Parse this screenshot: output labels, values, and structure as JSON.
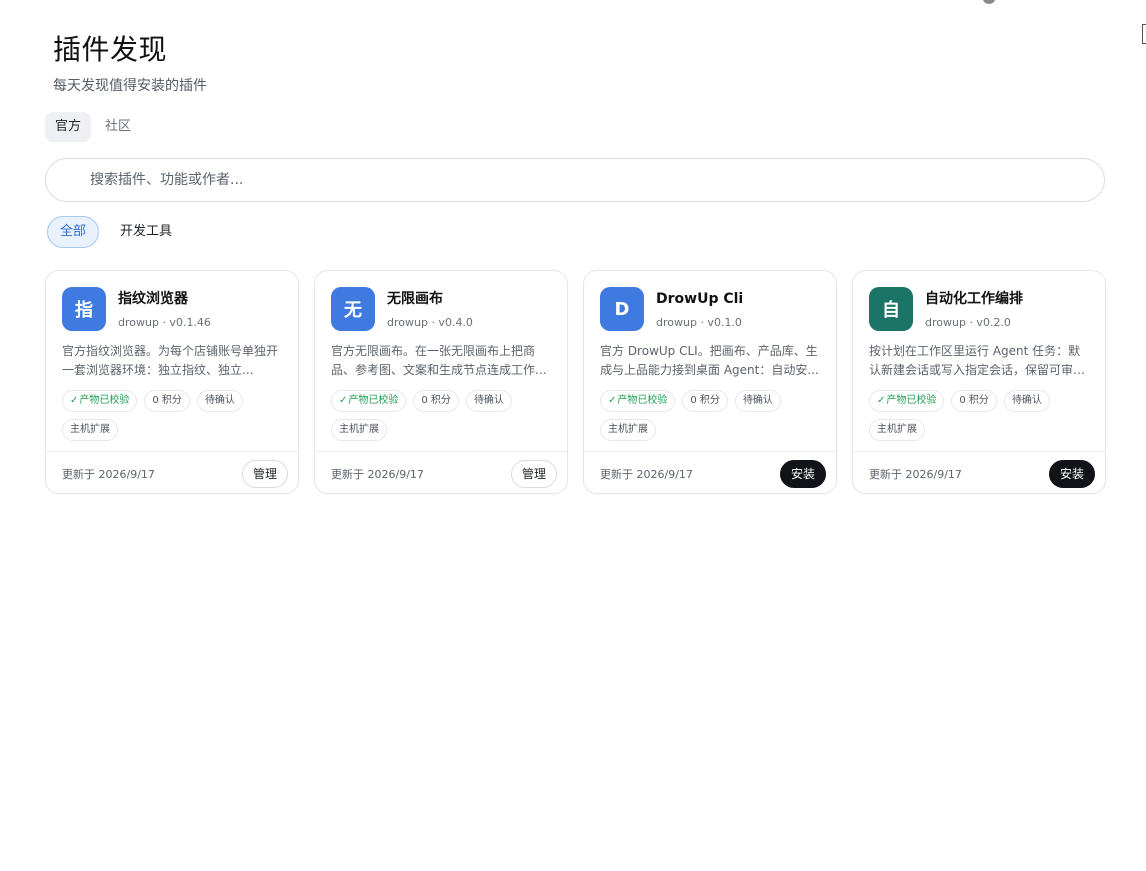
{
  "header": {
    "title": "插件发现",
    "subtitle": "每天发现值得安装的插件"
  },
  "source_tabs": [
    {
      "label": "官方",
      "active": true
    },
    {
      "label": "社区",
      "active": false
    }
  ],
  "search": {
    "placeholder": "搜索插件、功能或作者..."
  },
  "filters": [
    {
      "label": "全部",
      "active": true
    },
    {
      "label": "开发工具",
      "active": false
    }
  ],
  "colors": {
    "accent_blue": "#3f7ae0",
    "accent_teal": "#1a7566",
    "verified_green": "#1f9d55",
    "install_button": "#111318"
  },
  "plugins": [
    {
      "icon_text": "指",
      "icon_color": "#3f7ae0",
      "name": "指纹浏览器",
      "meta": "drowup · v0.1.46",
      "description": "官方指纹浏览器。为每个店铺账号单独开一套浏览器环境：独立指纹、独立...",
      "tags": {
        "verified": "产物已校验",
        "points": "0 积分",
        "status": "待确认",
        "type": "主机扩展"
      },
      "updated": "更新于 2026/9/17",
      "action": "管理",
      "action_kind": "manage"
    },
    {
      "icon_text": "无",
      "icon_color": "#3f7ae0",
      "name": "无限画布",
      "meta": "drowup · v0.4.0",
      "description": "官方无限画布。在一张无限画布上把商品、参考图、文案和生成节点连成工作...",
      "tags": {
        "verified": "产物已校验",
        "points": "0 积分",
        "status": "待确认",
        "type": "主机扩展"
      },
      "updated": "更新于 2026/9/17",
      "action": "管理",
      "action_kind": "manage"
    },
    {
      "icon_text": "D",
      "icon_color": "#3f7ae0",
      "name": "DrowUp Cli",
      "meta": "drowup · v0.1.0",
      "description": "官方 DrowUp CLI。把画布、产品库、生成与上品能力接到桌面 Agent：自动安...",
      "tags": {
        "verified": "产物已校验",
        "points": "0 积分",
        "status": "待确认",
        "type": "主机扩展"
      },
      "updated": "更新于 2026/9/17",
      "action": "安装",
      "action_kind": "install"
    },
    {
      "icon_text": "自",
      "icon_color": "#1a7566",
      "name": "自动化工作编排",
      "meta": "drowup · v0.2.0",
      "description": "按计划在工作区里运行 Agent 任务：默认新建会话或写入指定会话，保留可审计...",
      "tags": {
        "verified": "产物已校验",
        "points": "0 积分",
        "status": "待确认",
        "type": "主机扩展"
      },
      "updated": "更新于 2026/9/17",
      "action": "安装",
      "action_kind": "install"
    }
  ]
}
